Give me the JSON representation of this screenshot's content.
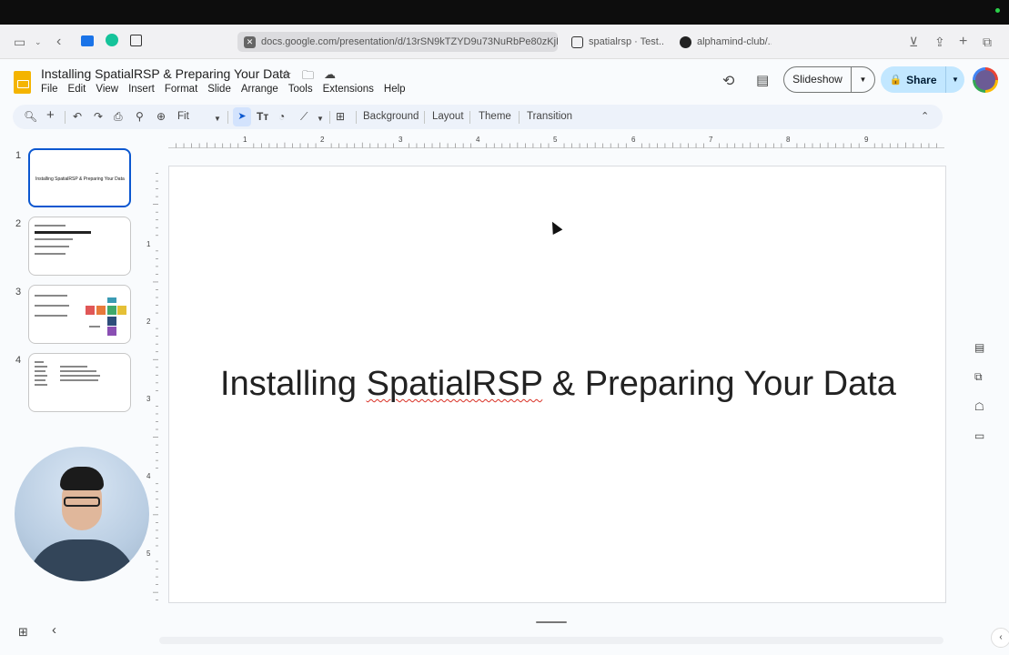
{
  "browser": {
    "tabs": [
      {
        "label": "docs.google.com/presentation/d/13rSN9kTZYD9u73NuRbPe80zKjK",
        "active": true
      },
      {
        "label": "spatialrsp · Test..."
      },
      {
        "label": "alphamind-club/..."
      }
    ]
  },
  "app": {
    "title": "Installing SpatialRSP & Preparing Your Data",
    "menu": [
      "File",
      "Edit",
      "View",
      "Insert",
      "Format",
      "Slide",
      "Arrange",
      "Tools",
      "Extensions",
      "Help"
    ],
    "slideshow_label": "Slideshow",
    "share_label": "Share"
  },
  "toolbar": {
    "zoom": "Fit",
    "buttons": [
      "Background",
      "Layout",
      "Theme",
      "Transition"
    ]
  },
  "filmstrip": {
    "numbers": [
      "1",
      "2",
      "3",
      "4"
    ],
    "slide1_text": "Installing SpatialRSP & Preparing Your Data"
  },
  "ruler": {
    "top": [
      "1",
      "2",
      "3",
      "4",
      "5",
      "6",
      "7",
      "8",
      "9"
    ],
    "left": [
      "1",
      "2",
      "3",
      "4",
      "5"
    ]
  },
  "slide": {
    "title_plain_a": "Installing ",
    "title_spell": "SpatialRSP",
    "title_plain_b": " & Preparing Your Data"
  },
  "colors": {
    "accent": "#0b57d0",
    "share_bg": "#c2e7ff",
    "slides_yellow": "#f4b400"
  },
  "icons": [
    "sidebar-icon",
    "back-icon",
    "search-icon",
    "undo-icon",
    "redo-icon",
    "print-icon",
    "paint-format-icon",
    "zoom-icon",
    "select-icon",
    "text-box-icon",
    "shape-icon",
    "line-icon",
    "comment-add-icon",
    "history-icon",
    "comment-icon",
    "lock-icon"
  ]
}
